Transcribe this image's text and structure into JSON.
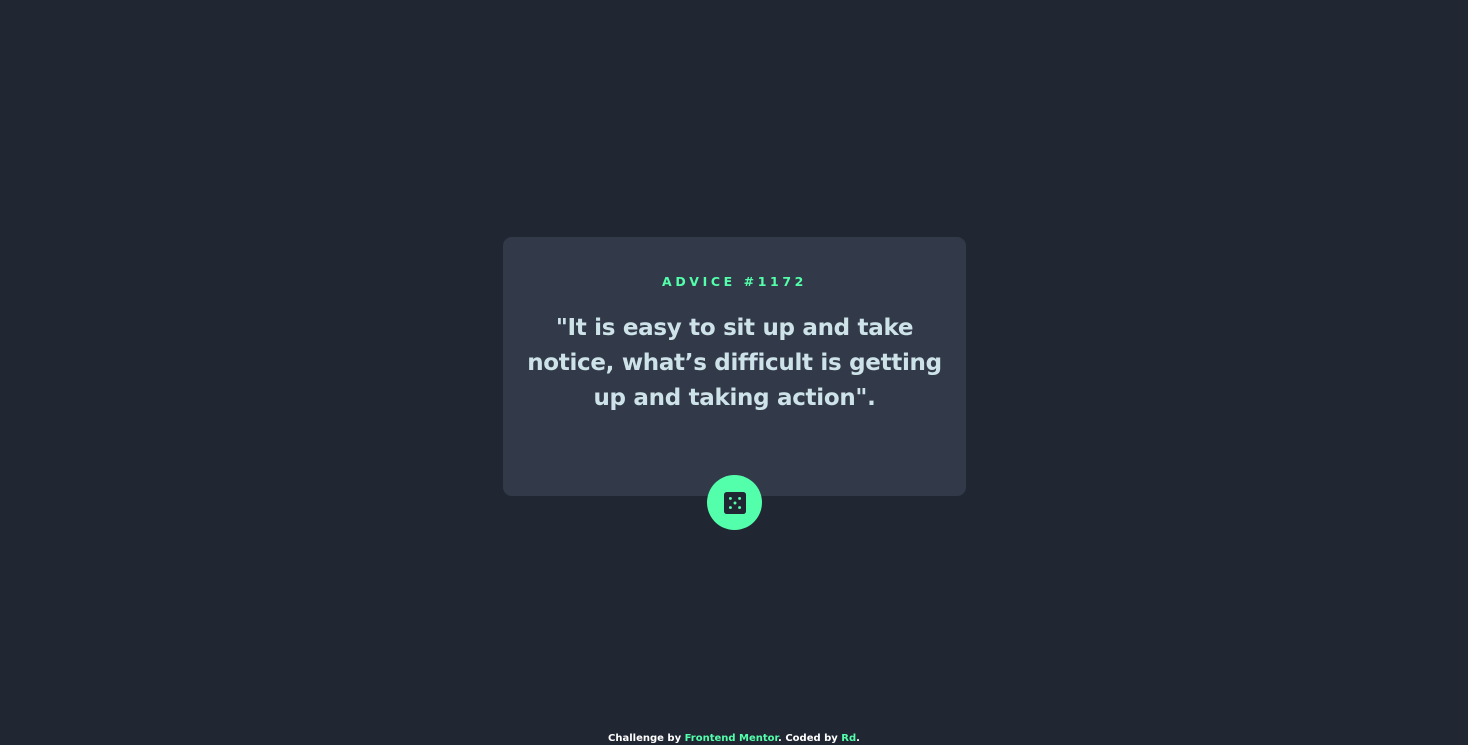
{
  "card": {
    "label": "ADVICE #1172",
    "quote": "\"It is easy to sit up and take notice, what’s difficult is getting up and taking action\"."
  },
  "dice_button": {
    "icon": "dice-icon"
  },
  "footer": {
    "prefix": "Challenge by ",
    "challenge_link": "Frontend Mentor",
    "middle": ". Coded by ",
    "author_link": "Rd",
    "suffix": "."
  },
  "colors": {
    "background": "#202733",
    "card": "#323a49",
    "accent": "#53ffab",
    "text": "#cee3e9"
  }
}
